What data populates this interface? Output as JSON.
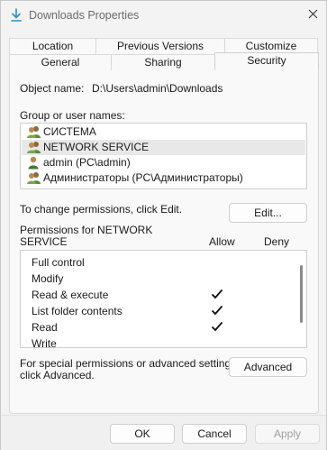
{
  "window": {
    "title": "Downloads Properties"
  },
  "tabs": {
    "row_back": [
      "Location",
      "Previous Versions",
      "Customize"
    ],
    "row_front": [
      "General",
      "Sharing",
      "Security"
    ],
    "active": "Security"
  },
  "security": {
    "object_name_label": "Object name:",
    "object_name_value": "D:\\Users\\admin\\Downloads",
    "group_label": "Group or user names:",
    "users": [
      {
        "name": "СИСТЕМА",
        "icon": "users-group-icon",
        "selected": false
      },
      {
        "name": "NETWORK SERVICE",
        "icon": "users-group-icon",
        "selected": true
      },
      {
        "name": "admin (PC\\admin)",
        "icon": "user-icon",
        "selected": false
      },
      {
        "name": "Администраторы (PC\\Администраторы)",
        "icon": "users-group-icon",
        "selected": false
      }
    ],
    "change_hint": "To change permissions, click Edit.",
    "edit_button": "Edit...",
    "permissions_for_line1": "Permissions for NETWORK",
    "permissions_for_line2": "SERVICE",
    "allow_header": "Allow",
    "deny_header": "Deny",
    "permissions": [
      {
        "name": "Full control",
        "allow": false,
        "deny": false
      },
      {
        "name": "Modify",
        "allow": false,
        "deny": false
      },
      {
        "name": "Read & execute",
        "allow": true,
        "deny": false
      },
      {
        "name": "List folder contents",
        "allow": true,
        "deny": false
      },
      {
        "name": "Read",
        "allow": true,
        "deny": false
      },
      {
        "name": "Write",
        "allow": false,
        "deny": false
      }
    ],
    "advanced_hint_line1": "For special permissions or advanced settings,",
    "advanced_hint_line2": "click Advanced.",
    "advanced_button": "Advanced"
  },
  "footer": {
    "ok": "OK",
    "cancel": "Cancel",
    "apply": "Apply",
    "apply_disabled": true
  },
  "colors": {
    "accent": "#2b7bd0",
    "check": "#111111",
    "disabled_text": "#a0a0a0"
  }
}
